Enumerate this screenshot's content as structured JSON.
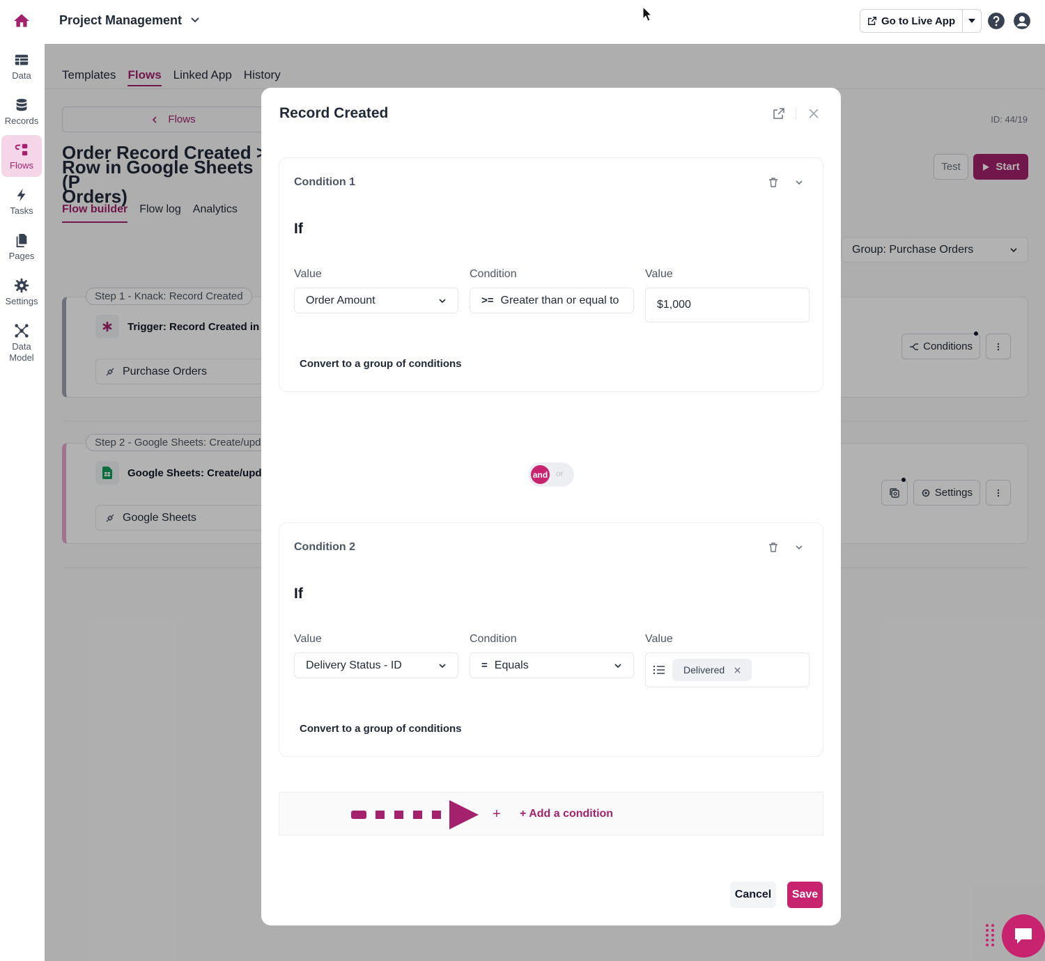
{
  "topbar": {
    "app_title": "Project Management",
    "live_app_label": "Go to Live App"
  },
  "sidebar": {
    "items": [
      {
        "label": "Data",
        "icon": "table-icon"
      },
      {
        "label": "Records",
        "icon": "database-icon"
      },
      {
        "label": "Flows",
        "icon": "flows-icon",
        "active": true
      },
      {
        "label": "Tasks",
        "icon": "bolt-icon"
      },
      {
        "label": "Pages",
        "icon": "pages-icon"
      },
      {
        "label": "Settings",
        "icon": "gear-icon"
      },
      {
        "label": "Data Model",
        "icon": "data-model-icon"
      }
    ]
  },
  "page": {
    "tabs": [
      "Templates",
      "Flows",
      "Linked App",
      "History"
    ],
    "active_tab": "Flows",
    "back_label": "Flows",
    "flow_title": "Order Record Created >\nRow in Google Sheets (P\nOrders)",
    "id_label": "ID: 44/19",
    "test_label": "Test",
    "start_label": "Start",
    "subtabs": [
      "Flow builder",
      "Flow log",
      "Analytics"
    ],
    "group_select": "Group: Purchase Orders",
    "steps": [
      {
        "label": "Step 1 - Knack: Record Created",
        "title": "Trigger: Record Created in (",
        "app": "Purchase Orders",
        "action": "Conditions"
      },
      {
        "label": "Step 2 - Google Sheets: Create/upd",
        "title": "Google Sheets: Create/upd",
        "app": "Google Sheets",
        "action": "Settings"
      }
    ]
  },
  "modal": {
    "title": "Record Created",
    "conditions": [
      {
        "title": "Condition 1",
        "if_label": "If",
        "value_label": "Value",
        "condition_label": "Condition",
        "value2_label": "Value",
        "field": "Order Amount",
        "operator_symbol": ">=",
        "operator": "Greater than or equal to",
        "value": "$1,000",
        "convert_label": "Convert to a group of conditions"
      },
      {
        "title": "Condition 2",
        "if_label": "If",
        "value_label": "Value",
        "condition_label": "Condition",
        "value2_label": "Value",
        "field": "Delivery Status - ID",
        "operator_symbol": "=",
        "operator": "Equals",
        "chip": "Delivered",
        "convert_label": "Convert to a group of conditions"
      }
    ],
    "toggle": {
      "and": "and",
      "or": "or"
    },
    "add_plus": "+",
    "add_condition": "+ Add a condition",
    "cancel": "Cancel",
    "save": "Save"
  },
  "colors": {
    "brand": "#a4226d",
    "brand_bright": "#c7236f"
  }
}
